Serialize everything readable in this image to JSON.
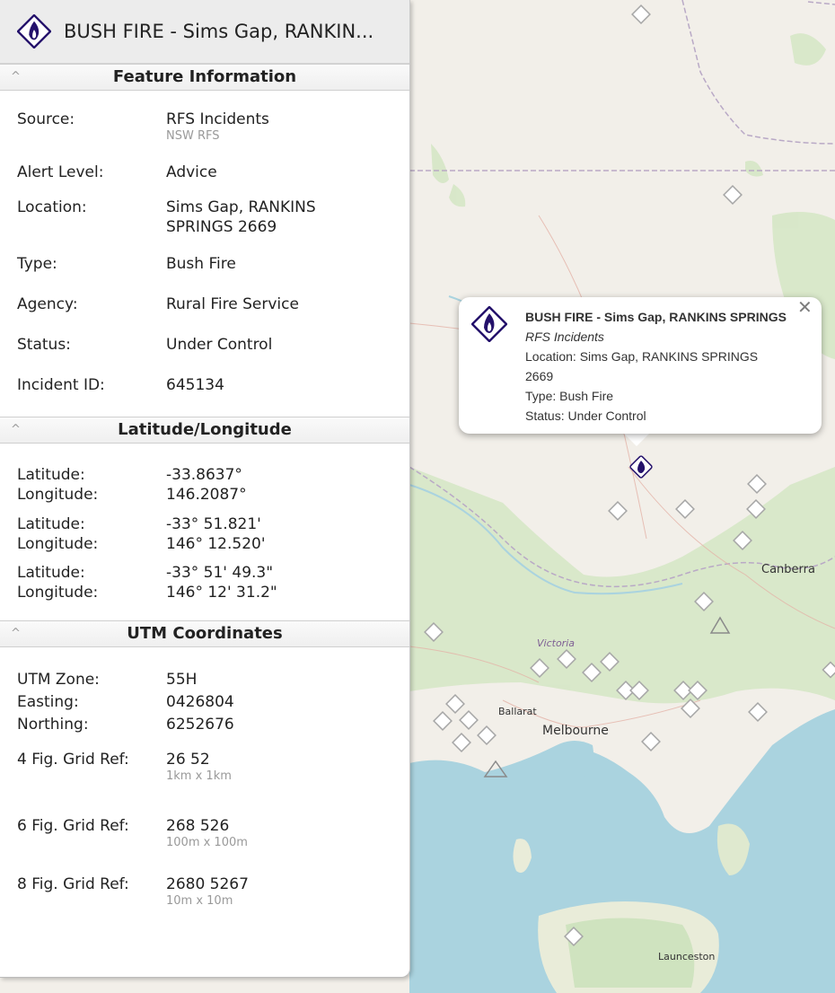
{
  "panel": {
    "title": "BUSH FIRE - Sims Gap, RANKIN...",
    "feature_section": {
      "heading": "Feature Information",
      "rows": [
        {
          "label": "Source:",
          "value": "RFS Incidents",
          "sub": "NSW RFS"
        },
        {
          "label": "Alert Level:",
          "value": "Advice"
        },
        {
          "label": "Location:",
          "value": "Sims Gap, RANKINS",
          "value2": "SPRINGS 2669"
        },
        {
          "label": "Type:",
          "value": "Bush Fire"
        },
        {
          "label": "Agency:",
          "value": "Rural Fire Service"
        },
        {
          "label": "Status:",
          "value": "Under Control"
        },
        {
          "label": "Incident ID:",
          "value": "645134"
        }
      ]
    },
    "latlon_section": {
      "heading": "Latitude/Longitude",
      "groups": [
        {
          "lat_label": "Latitude:",
          "lat": "-33.8637°",
          "lon_label": "Longitude:",
          "lon": "146.2087°"
        },
        {
          "lat_label": "Latitude:",
          "lat": "-33° 51.821'",
          "lon_label": "Longitude:",
          "lon": "146° 12.520'"
        },
        {
          "lat_label": "Latitude:",
          "lat": "-33° 51' 49.3\"",
          "lon_label": "Longitude:",
          "lon": "146° 12' 31.2\""
        }
      ]
    },
    "utm_section": {
      "heading": "UTM Coordinates",
      "zone_label": "UTM Zone:",
      "zone": "55H",
      "easting_label": "Easting:",
      "easting": "0426804",
      "northing_label": "Northing:",
      "northing": "6252676",
      "grid_refs": [
        {
          "label": "4 Fig. Grid Ref:",
          "value": "26 52",
          "sub": "1km x 1km"
        },
        {
          "label": "6 Fig. Grid Ref:",
          "value": "268 526",
          "sub": "100m x 100m"
        },
        {
          "label": "8 Fig. Grid Ref:",
          "value": "2680 5267",
          "sub": "10m x 10m"
        }
      ]
    },
    "caret": "^"
  },
  "popup": {
    "title": "BUSH FIRE - Sims Gap, RANKINS SPRINGS",
    "source": "RFS Incidents",
    "location": "Location: Sims Gap, RANKINS SPRINGS",
    "location2": "2669",
    "type": "Type: Bush Fire",
    "status": "Status: Under Control",
    "close": "✕"
  },
  "map_labels": {
    "canberra": "Canberra",
    "victoria": "Victoria",
    "ballarat": "Ballarat",
    "melbourne": "Melbourne",
    "launceston": "Launceston"
  },
  "icons": {
    "title": "fire-incident-icon",
    "popup": "fire-incident-icon",
    "marker": "fire-marker-icon",
    "close": "close-icon"
  },
  "colors": {
    "fire_icon": "#24116b",
    "water": "#aad3df",
    "land": "#f2efe9",
    "forest": "#d2e5c0",
    "panel_header": "#ececec"
  }
}
